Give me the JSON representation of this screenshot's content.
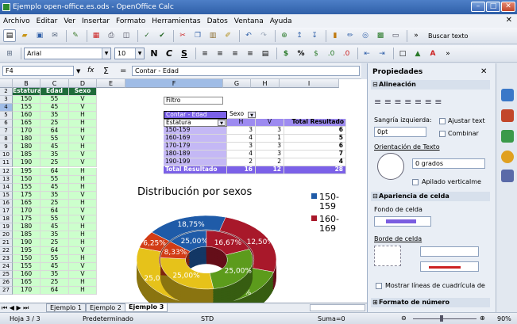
{
  "window": {
    "title": "Ejemplo open-office.es.ods - OpenOffice Calc",
    "min": "–",
    "max": "□",
    "close": "✕"
  },
  "menu": [
    "Archivo",
    "Editar",
    "Ver",
    "Insertar",
    "Formato",
    "Herramientas",
    "Datos",
    "Ventana",
    "Ayuda"
  ],
  "toolbar": {
    "buscar": "Buscar texto",
    "font": "Arial",
    "size": "10"
  },
  "formula": {
    "ref": "F4",
    "content": "Contar - Edad",
    "fx": "fx",
    "sum": "Σ",
    "eq": "="
  },
  "columns": [
    "B",
    "C",
    "D",
    "E",
    "F",
    "G",
    "H",
    "I"
  ],
  "rows": [
    [
      "2",
      "Estatura",
      "Edad",
      "Sexo"
    ],
    [
      "3",
      "150",
      "55",
      "V"
    ],
    [
      "4",
      "155",
      "45",
      "V"
    ],
    [
      "5",
      "160",
      "35",
      "H"
    ],
    [
      "6",
      "165",
      "25",
      "H"
    ],
    [
      "7",
      "170",
      "64",
      "H"
    ],
    [
      "8",
      "180",
      "55",
      "V"
    ],
    [
      "9",
      "180",
      "45",
      "H"
    ],
    [
      "10",
      "185",
      "35",
      "V"
    ],
    [
      "11",
      "190",
      "25",
      "V"
    ],
    [
      "12",
      "195",
      "64",
      "H"
    ],
    [
      "13",
      "150",
      "55",
      "H"
    ],
    [
      "14",
      "155",
      "45",
      "H"
    ],
    [
      "15",
      "175",
      "35",
      "V"
    ],
    [
      "16",
      "165",
      "25",
      "H"
    ],
    [
      "17",
      "170",
      "64",
      "V"
    ],
    [
      "18",
      "175",
      "55",
      "V"
    ],
    [
      "19",
      "180",
      "45",
      "H"
    ],
    [
      "20",
      "185",
      "35",
      "H"
    ],
    [
      "21",
      "190",
      "25",
      "H"
    ],
    [
      "22",
      "195",
      "64",
      "V"
    ],
    [
      "23",
      "150",
      "55",
      "H"
    ],
    [
      "24",
      "155",
      "45",
      "V"
    ],
    [
      "25",
      "160",
      "35",
      "V"
    ],
    [
      "26",
      "165",
      "25",
      "H"
    ],
    [
      "27",
      "170",
      "64",
      "H"
    ]
  ],
  "pivot": {
    "filter_label": "Filtro",
    "data_label": "Contar - Edad",
    "col_field": "Sexo",
    "row_field": "Estatura",
    "col_items": [
      "H",
      "V",
      "Total Resultado"
    ],
    "rows": [
      [
        "150-159",
        "3",
        "3",
        "6"
      ],
      [
        "160-169",
        "4",
        "1",
        "5"
      ],
      [
        "170-179",
        "3",
        "3",
        "6"
      ],
      [
        "180-189",
        "4",
        "3",
        "7"
      ],
      [
        "190-199",
        "2",
        "2",
        "4"
      ]
    ],
    "total": [
      "Total Resultado",
      "16",
      "12",
      "28"
    ]
  },
  "chart_data": {
    "type": "pie",
    "title": "Distribución por sexos",
    "legend": [
      "150-159",
      "160-169"
    ],
    "series": [
      {
        "values": [
          18.75,
          25.0,
          25.0,
          25.0,
          6.25
        ]
      },
      {
        "values": [
          12.5,
          16.67,
          25.0,
          25.0,
          8.33
        ]
      }
    ],
    "labels_outer": [
      "18,75%",
      "12,50%",
      "25,00%",
      "25,00%",
      "6,25%"
    ],
    "labels_inner": [
      "25,00%",
      "16,67%",
      "25,00%",
      "25,00%",
      "8,33%"
    ],
    "colors": [
      "#1f5ba8",
      "#a8182a",
      "#5c9b1c",
      "#e6c21a",
      "#d23c16"
    ]
  },
  "sheets": [
    "Ejemplo 1",
    "Ejemplo 2",
    "Ejemplo 3"
  ],
  "status": {
    "sheet": "Hoja 3 / 3",
    "style": "Predeterminado",
    "mode": "STD",
    "sum": "Suma=0",
    "zoom": "90%"
  },
  "sidebar": {
    "title": "Propiedades",
    "alignment": "Alineación",
    "indent_label": "Sangría izquierda:",
    "indent_value": "0pt",
    "wrap": "Ajustar text",
    "merge": "Combinar",
    "orientation": "Orientación de Texto",
    "degrees": "0 grados",
    "vertical": "Apilado verticalme",
    "appearance": "Apariencia de celda",
    "bg": "Fondo de celda",
    "border": "Borde de celda",
    "gridlines": "Mostrar líneas de cuadrícula de",
    "numformat": "Formato de número"
  }
}
